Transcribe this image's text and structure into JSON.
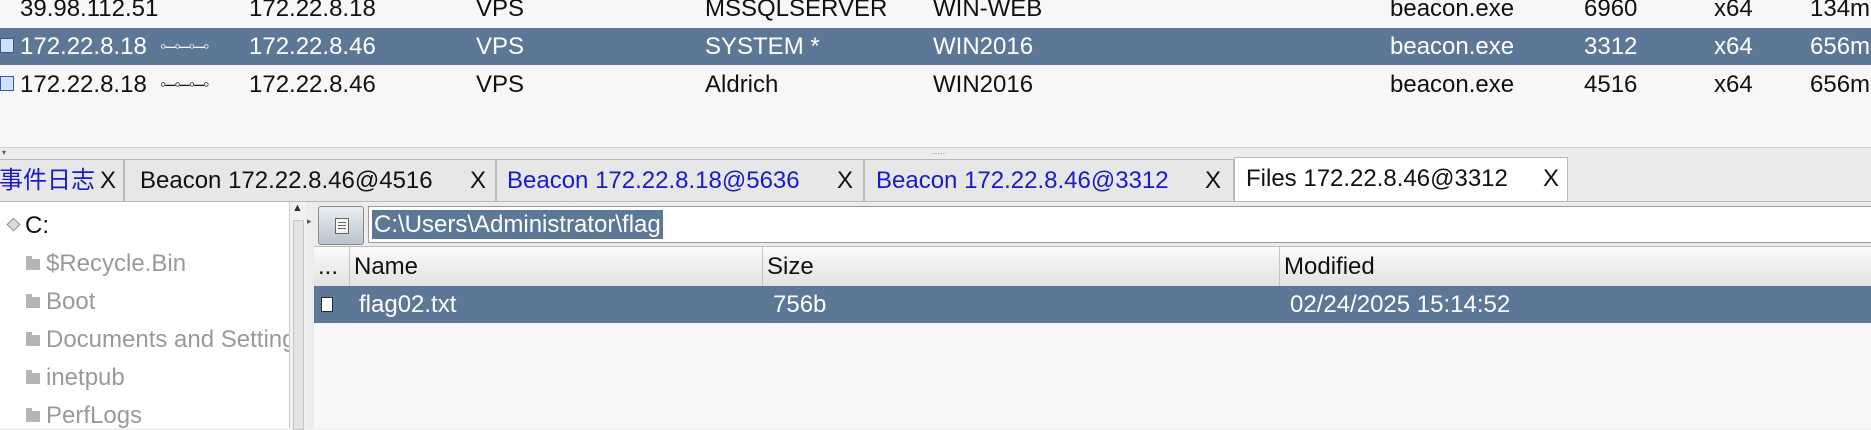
{
  "sessions": [
    {
      "external": "39.98.112.51",
      "internal": "172.22.8.18",
      "listener": "VPS",
      "user": "MSSQLSERVER",
      "computer": "WIN-WEB",
      "process": "beacon.exe",
      "pid": "6960",
      "arch": "x64",
      "last": "134m",
      "chain": "",
      "selected": false
    },
    {
      "external": "172.22.8.18",
      "internal": "172.22.8.46",
      "listener": "VPS",
      "user": "SYSTEM *",
      "computer": "WIN2016",
      "process": "beacon.exe",
      "pid": "3312",
      "arch": "x64",
      "last": "656m",
      "chain": "◦–◦–◦–◦",
      "selected": true
    },
    {
      "external": "172.22.8.18",
      "internal": "172.22.8.46",
      "listener": "VPS",
      "user": "Aldrich",
      "computer": "WIN2016",
      "process": "beacon.exe",
      "pid": "4516",
      "arch": "x64",
      "last": "656m",
      "chain": "◦–◦–◦–◦",
      "selected": false
    }
  ],
  "tabs": [
    {
      "label": "事件日志",
      "close": "X",
      "color": "blue",
      "active": false
    },
    {
      "label": "Beacon 172.22.8.46@4516",
      "close": "X",
      "color": "default",
      "active": false
    },
    {
      "label": "Beacon 172.22.8.18@5636",
      "close": "X",
      "color": "blue",
      "active": false
    },
    {
      "label": "Beacon 172.22.8.46@3312",
      "close": "X",
      "color": "blue",
      "active": false
    },
    {
      "label": "Files 172.22.8.46@3312",
      "close": "X",
      "color": "default",
      "active": true
    }
  ],
  "tree": {
    "root": "C:",
    "items": [
      "$Recycle.Bin",
      "Boot",
      "Documents and Settings",
      "inetpub",
      "PerfLogs"
    ]
  },
  "path": {
    "value": "C:\\Users\\Administrator\\flag"
  },
  "files": {
    "headers": {
      "menu": "...",
      "name": "Name",
      "size": "Size",
      "modified": "Modified"
    },
    "rows": [
      {
        "name": "flag02.txt",
        "size": "756b",
        "modified": "02/24/2025 15:14:52",
        "selected": true
      }
    ]
  },
  "colors": {
    "selection": "#5d7797",
    "link_tab": "#1a1acc"
  }
}
